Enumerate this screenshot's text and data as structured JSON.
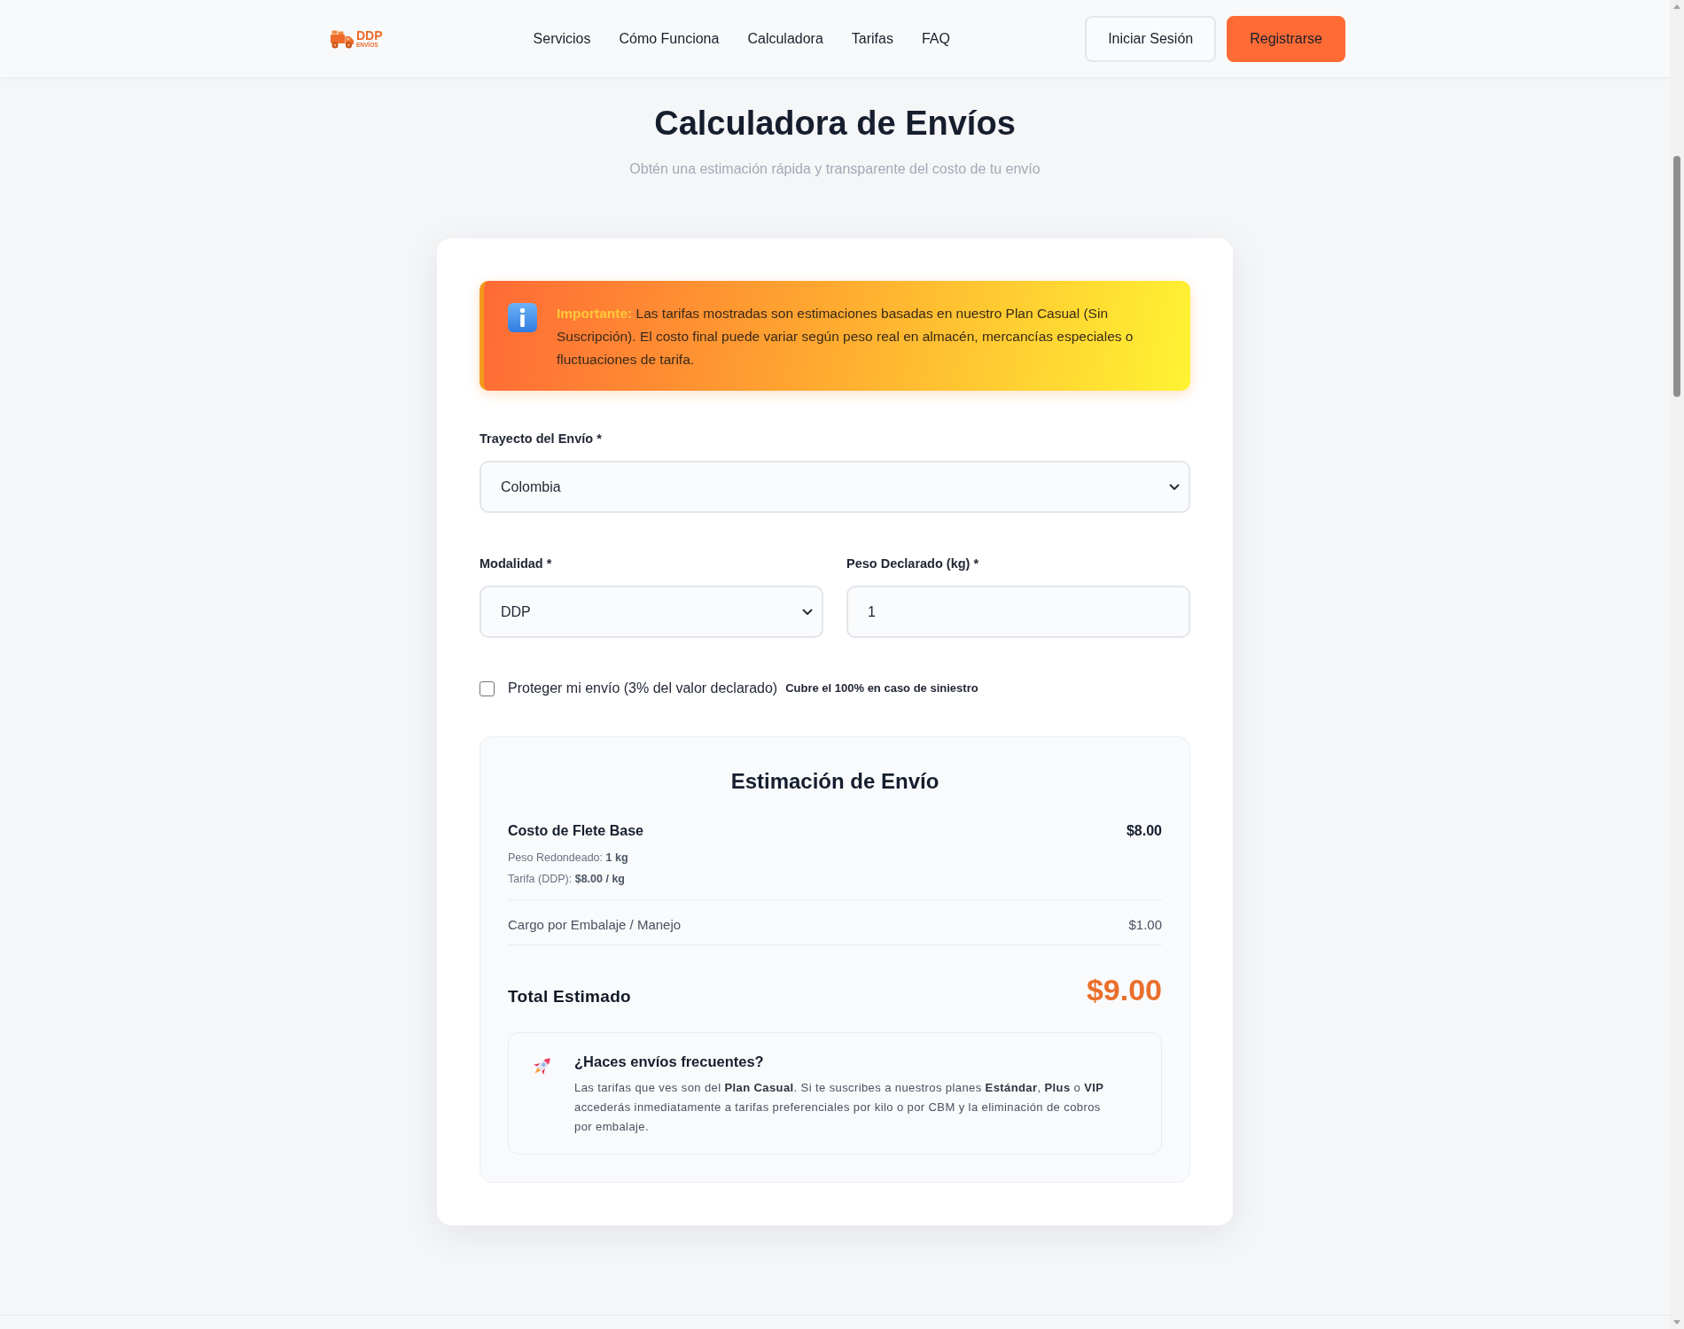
{
  "header": {
    "logo": {
      "title": "DDP",
      "subtitle": "ENVÍOS"
    },
    "nav": [
      "Servicios",
      "Cómo Funciona",
      "Calculadora",
      "Tarifas",
      "FAQ"
    ],
    "actions": [
      {
        "label": "Iniciar Sesión",
        "kind": "outline"
      },
      {
        "label": "Registrarse",
        "kind": "primary"
      }
    ]
  },
  "intro": {
    "title": "Calculadora de Envíos",
    "subtitle": "Obtén una estimación rápida y transparente del costo de tu envío"
  },
  "notice": {
    "text": "**Importante:** Las tarifas mostradas son estimaciones basadas en nuestro Plan Casual (Sin Suscripción). El costo final puede variar según peso real en almacén, mercancías especiales o fluctuaciones de tarifa."
  },
  "form": {
    "rows": [
      {
        "fields": [
          {
            "kind": "select",
            "label": "Trayecto del Envío *",
            "value": "Colombia"
          }
        ]
      },
      {
        "fields": [
          {
            "kind": "select",
            "label": "Modalidad *",
            "value": "DDP"
          },
          {
            "kind": "number",
            "label": "Peso Declarado (kg) *",
            "value": "1"
          }
        ]
      }
    ],
    "protection": {
      "label": "Proteger mi envío (3% del valor declarado)",
      "note": "Cubre el 100% en caso de siniestro",
      "checked": false
    }
  },
  "estimate": {
    "title": "Estimación de Envío",
    "base": {
      "label": "Costo de Flete Base",
      "amount": "$8.00",
      "details": [
        "Peso Redondeado: **1 kg**",
        "Tarifa (DDP): **$8.00 / kg**"
      ]
    },
    "charges": [
      {
        "label": "Cargo por Embalaje / Manejo",
        "amount": "$1.00"
      }
    ],
    "total": {
      "label": "Total Estimado",
      "amount": "$9.00"
    },
    "promo": {
      "title": "¿Haces envíos frecuentes?",
      "text": "Las tarifas que ves son del **Plan Casual**. Si te suscribes a nuestros planes **Estándar**, **Plus** o **VIP** accederás inmediatamente a tarifas preferenciales por kilo o por CBM y la eliminación de cobros por embalaje."
    }
  }
}
